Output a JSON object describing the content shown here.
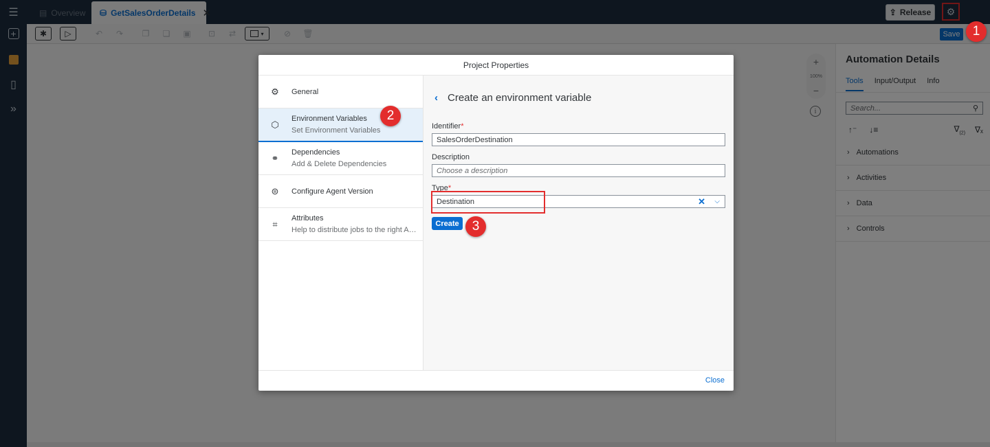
{
  "topbar": {
    "tabs": [
      {
        "label": "Overview",
        "active": false
      },
      {
        "label": "GetSalesOrderDetails",
        "active": true
      }
    ],
    "release_label": "Release"
  },
  "toolbar": {
    "save_label": "Save"
  },
  "zoom": {
    "level": "100%"
  },
  "right_panel": {
    "title": "Automation Details",
    "tabs": [
      "Tools",
      "Input/Output",
      "Info"
    ],
    "search_placeholder": "Search...",
    "filter_count": "(2)",
    "sections": [
      "Automations",
      "Activities",
      "Data",
      "Controls"
    ]
  },
  "dialog": {
    "title": "Project Properties",
    "nav": [
      {
        "label": "General",
        "sub": "",
        "icon": "gear-icon"
      },
      {
        "label": "Environment Variables",
        "sub": "Set Environment Variables",
        "icon": "cube-icon"
      },
      {
        "label": "Dependencies",
        "sub": "Add & Delete Dependencies",
        "icon": "link-icon"
      },
      {
        "label": "Configure Agent Version",
        "sub": "",
        "icon": "agent-icon"
      },
      {
        "label": "Attributes",
        "sub": "Help to distribute jobs to the right Ag...",
        "icon": "tag-icon"
      }
    ],
    "form": {
      "title": "Create an environment variable",
      "identifier_label": "Identifier",
      "identifier_value": "SalesOrderDestination",
      "description_label": "Description",
      "description_placeholder": "Choose a description",
      "type_label": "Type",
      "type_value": "Destination",
      "create_label": "Create"
    },
    "close_label": "Close"
  },
  "badges": [
    "1",
    "2",
    "3"
  ],
  "colors": {
    "accent": "#0a6ed1",
    "shell": "#1d2d3e",
    "highlight": "#e32d2d"
  }
}
